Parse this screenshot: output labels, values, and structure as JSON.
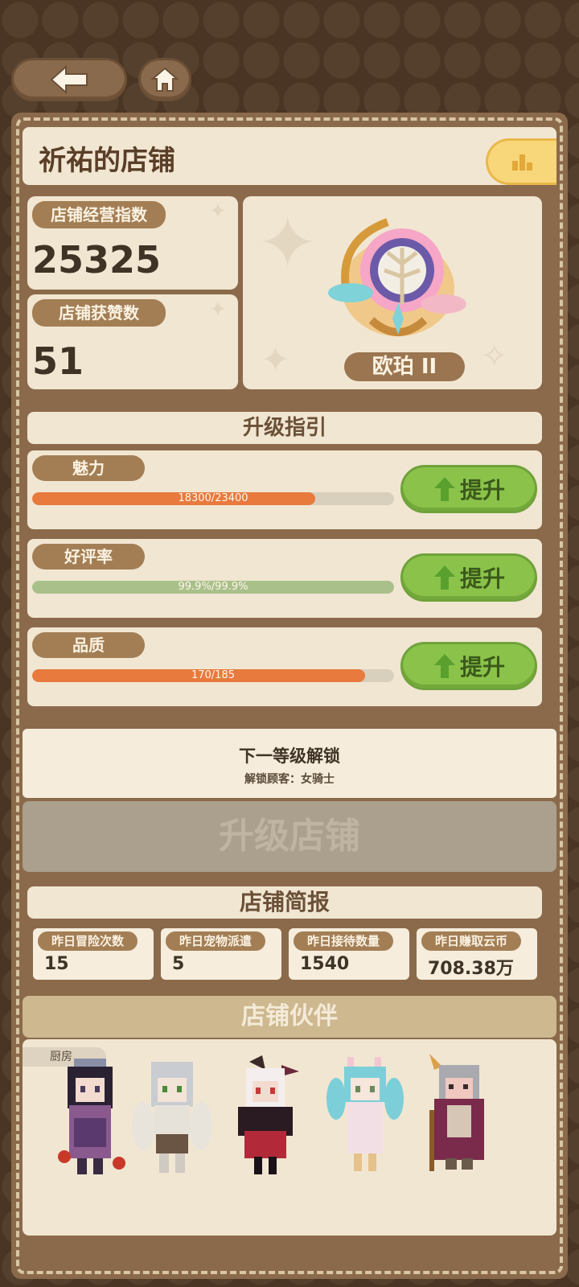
{
  "nav": {
    "back_icon": "arrow-left-icon",
    "home_icon": "home-icon"
  },
  "shop": {
    "title": "祈祐的店铺",
    "rank_icon": "bar-chart-icon"
  },
  "stats": {
    "business_index_label": "店铺经营指数",
    "business_index_value": "25325",
    "likes_label": "店铺获赞数",
    "likes_value": "51"
  },
  "rank_badge": {
    "name": "欧珀 II",
    "icon": "tree-emblem-icon",
    "accent": "#f1c173"
  },
  "guide": {
    "title": "升级指引",
    "rows": [
      {
        "label": "魅力",
        "progress_text": "18300/23400",
        "progress": 0.782,
        "color": "#e87a3e",
        "button": "提升"
      },
      {
        "label": "好评率",
        "progress_text": "99.9%/99.9%",
        "progress": 1.0,
        "color": "#a9c08a",
        "button": "提升"
      },
      {
        "label": "品质",
        "progress_text": "170/185",
        "progress": 0.919,
        "color": "#e87a3e",
        "button": "提升"
      }
    ]
  },
  "unlock": {
    "title": "下一等级解锁",
    "subtitle": "解锁顾客：女骑士"
  },
  "upgrade_button": "升级店铺",
  "briefing": {
    "title": "店铺简报",
    "items": [
      {
        "label": "昨日冒险次数",
        "value": "15"
      },
      {
        "label": "昨日宠物派遣",
        "value": "5"
      },
      {
        "label": "昨日接待数量",
        "value": "1540"
      },
      {
        "label": "昨日赚取云币",
        "value": "708.38万"
      }
    ]
  },
  "partners": {
    "title": "店铺伙伴",
    "chef_tag": "厨房",
    "characters": [
      "dark-haired-chef-sprite",
      "white-haired-winged-sprite",
      "horned-red-sprite",
      "cyan-twintail-sprite",
      "old-sage-sprite"
    ]
  }
}
